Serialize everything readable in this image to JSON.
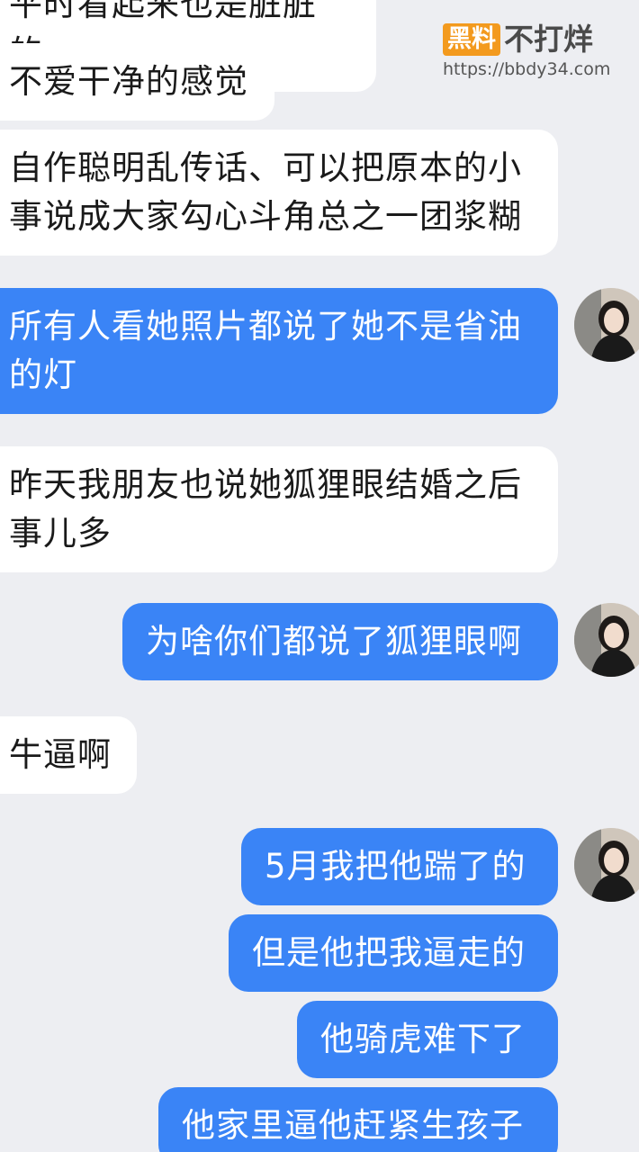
{
  "watermark": {
    "logo": "黑料",
    "text": "不打烊",
    "url": "https://bbdy34.com"
  },
  "messages": [
    {
      "text": "平时看起来也是脏脏的、",
      "direction": "incoming"
    },
    {
      "text": "不爱干净的感觉",
      "direction": "incoming"
    },
    {
      "text": "自作聪明乱传话、可以把原本的小\n事说成大家勾心斗角总之一团浆糊",
      "direction": "incoming"
    },
    {
      "text": "所有人看她照片都说了她不是省油\n的灯",
      "direction": "outgoing"
    },
    {
      "text": "昨天我朋友也说她狐狸眼结婚之后\n事儿多",
      "direction": "incoming"
    },
    {
      "text": "为啥你们都说了狐狸眼啊",
      "direction": "outgoing"
    },
    {
      "text": "牛逼啊",
      "direction": "incoming"
    },
    {
      "text": "5月我把他踹了的",
      "direction": "outgoing"
    },
    {
      "text": "但是他把我逼走的",
      "direction": "outgoing"
    },
    {
      "text": "他骑虎难下了",
      "direction": "outgoing"
    },
    {
      "text": "他家里逼他赶紧生孩子",
      "direction": "outgoing"
    }
  ]
}
